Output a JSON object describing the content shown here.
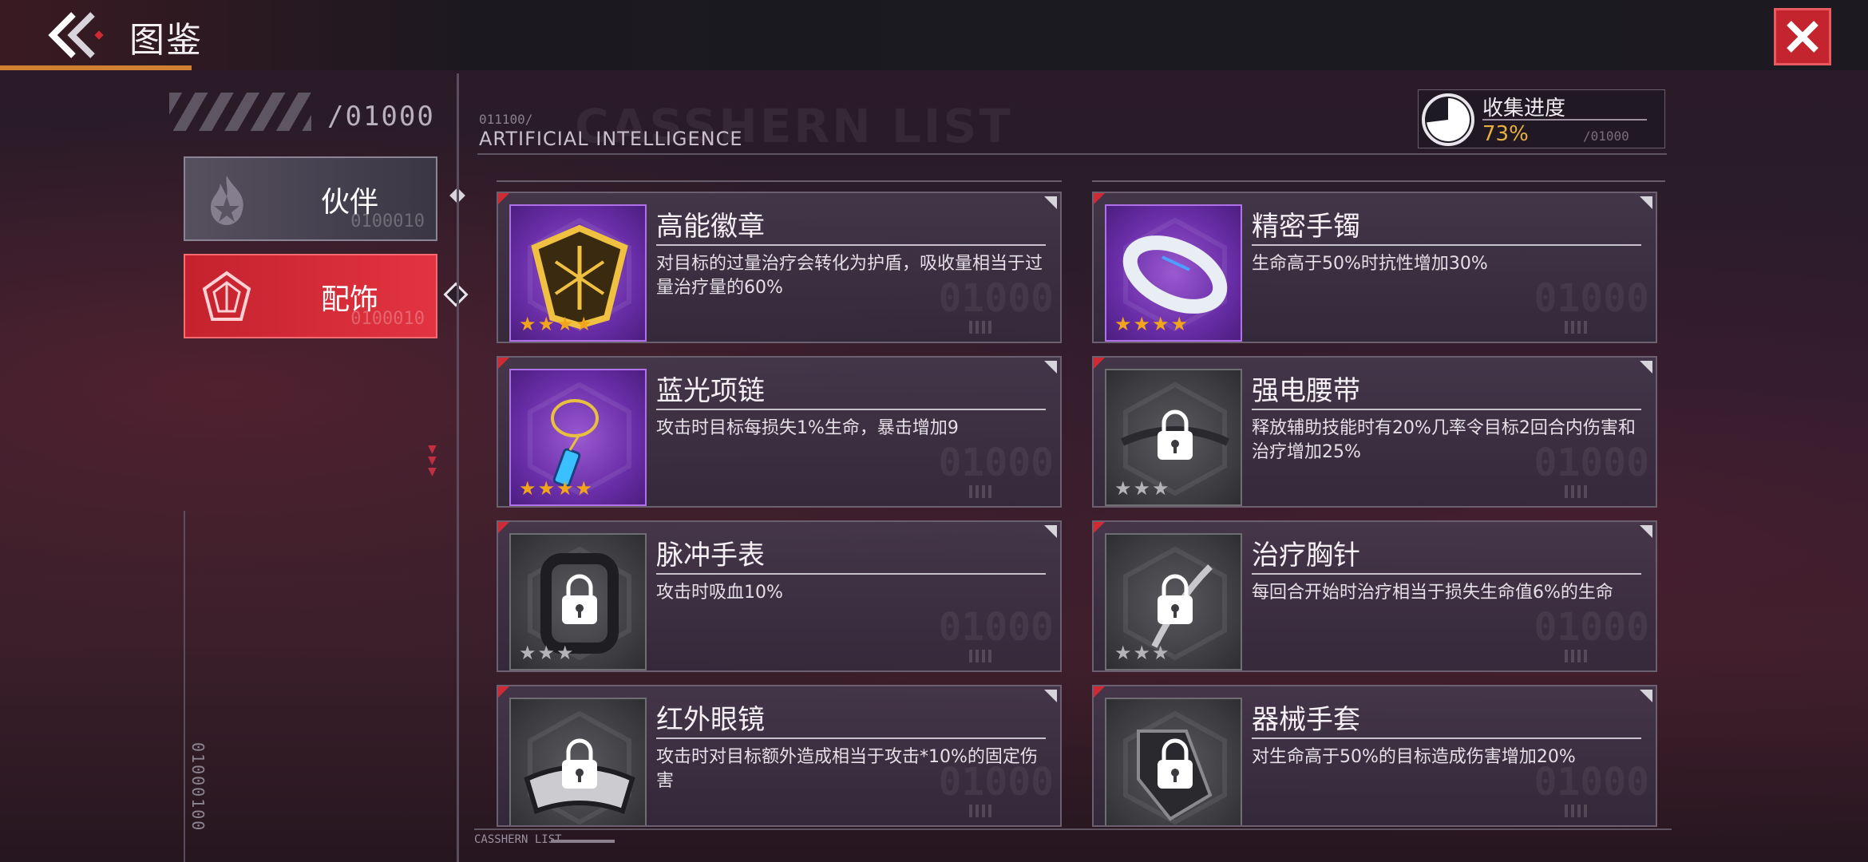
{
  "header": {
    "title": "图鉴",
    "colors": {
      "accent": "#c4242e",
      "brand": "#d08030"
    }
  },
  "sidebar": {
    "counter": "/01000",
    "tabs": [
      {
        "label": "伙伴",
        "deco": "0100010",
        "active": false
      },
      {
        "label": "配饰",
        "deco": "0100010",
        "active": true
      }
    ],
    "vertical_code": "01000100"
  },
  "main": {
    "code": "011100/",
    "section_title": "ARTIFICIAL INTELLIGENCE",
    "watermark_title": "CASSHERN LIST",
    "progress": {
      "label": "收集进度",
      "value": "73%",
      "fraction": 0.73,
      "code": "/01000"
    },
    "cards": [
      {
        "name": "高能徽章",
        "desc": "对目标的过量治疗会转化为护盾，吸收量相当于过量治疗量的60%",
        "stars": "★★★★",
        "unlocked": true,
        "icon": "badge-icon",
        "code": "01000"
      },
      {
        "name": "精密手镯",
        "desc": "生命高于50%时抗性增加30%",
        "stars": "★★★★",
        "unlocked": true,
        "icon": "bracelet-icon",
        "code": "01000"
      },
      {
        "name": "蓝光项链",
        "desc": "攻击时目标每损失1%生命，暴击增加9",
        "stars": "★★★★",
        "unlocked": true,
        "icon": "necklace-icon",
        "code": "01000"
      },
      {
        "name": "强电腰带",
        "desc": "释放辅助技能时有20%几率令目标2回合内伤害和治疗增加25%",
        "stars": "★★★",
        "unlocked": false,
        "icon": "belt-icon",
        "code": "01000"
      },
      {
        "name": "脉冲手表",
        "desc": "攻击时吸血10%",
        "stars": "★★★",
        "unlocked": false,
        "icon": "watch-icon",
        "code": "01000"
      },
      {
        "name": "治疗胸针",
        "desc": "每回合开始时治疗相当于损失生命值6%的生命",
        "stars": "★★★",
        "unlocked": false,
        "icon": "brooch-icon",
        "code": "01000"
      },
      {
        "name": "红外眼镜",
        "desc": "攻击时对目标额外造成相当于攻击*10%的固定伤害",
        "stars": "",
        "unlocked": false,
        "icon": "goggles-icon",
        "code": "01000"
      },
      {
        "name": "器械手套",
        "desc": "对生命高于50%的目标造成伤害增加20%",
        "stars": "",
        "unlocked": false,
        "icon": "glove-icon",
        "code": "01000"
      }
    ]
  },
  "footer": {
    "label": "CASSHERN LIST"
  }
}
